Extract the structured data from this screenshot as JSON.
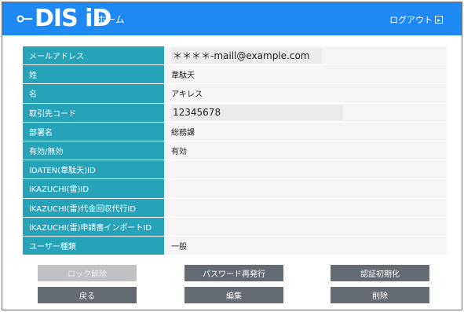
{
  "header": {
    "logo_text": "DIS iD",
    "home_label": "ホーム",
    "logout_label": "ログアウト"
  },
  "fields": [
    {
      "label": "メールアドレス",
      "value": "＊＊＊＊-maill@example.com"
    },
    {
      "label": "姓",
      "value": "韋駄天"
    },
    {
      "label": "名",
      "value": "アキレス"
    },
    {
      "label": "取引先コード",
      "value": "12345678"
    },
    {
      "label": "部署名",
      "value": "総務課"
    },
    {
      "label": "有効/無効",
      "value": "有効"
    },
    {
      "label": "iDATEN(韋駄天)ID",
      "value": ""
    },
    {
      "label": "iKAZUCHI(雷)ID",
      "value": ""
    },
    {
      "label": "iKAZUCHI(雷)代金回収代行ID",
      "value": ""
    },
    {
      "label": "iKAZUCHI(雷)申請書インポートID",
      "value": ""
    },
    {
      "label": "ユーザー種類",
      "value": "一般"
    }
  ],
  "buttons": {
    "unlock": {
      "label": "ロック解除",
      "enabled": false
    },
    "reissue_password": {
      "label": "パスワード再発行",
      "enabled": true
    },
    "reset_auth": {
      "label": "認証初期化",
      "enabled": true
    },
    "back": {
      "label": "戻る",
      "enabled": true
    },
    "edit": {
      "label": "編集",
      "enabled": true
    },
    "delete": {
      "label": "削除",
      "enabled": true
    }
  },
  "colors": {
    "header_bg": "#1e88f5",
    "label_bg": "#26a2b9",
    "value_bg": "#f5f5f5",
    "button_bg": "#646b73",
    "button_disabled_bg": "#bfc1c3"
  }
}
